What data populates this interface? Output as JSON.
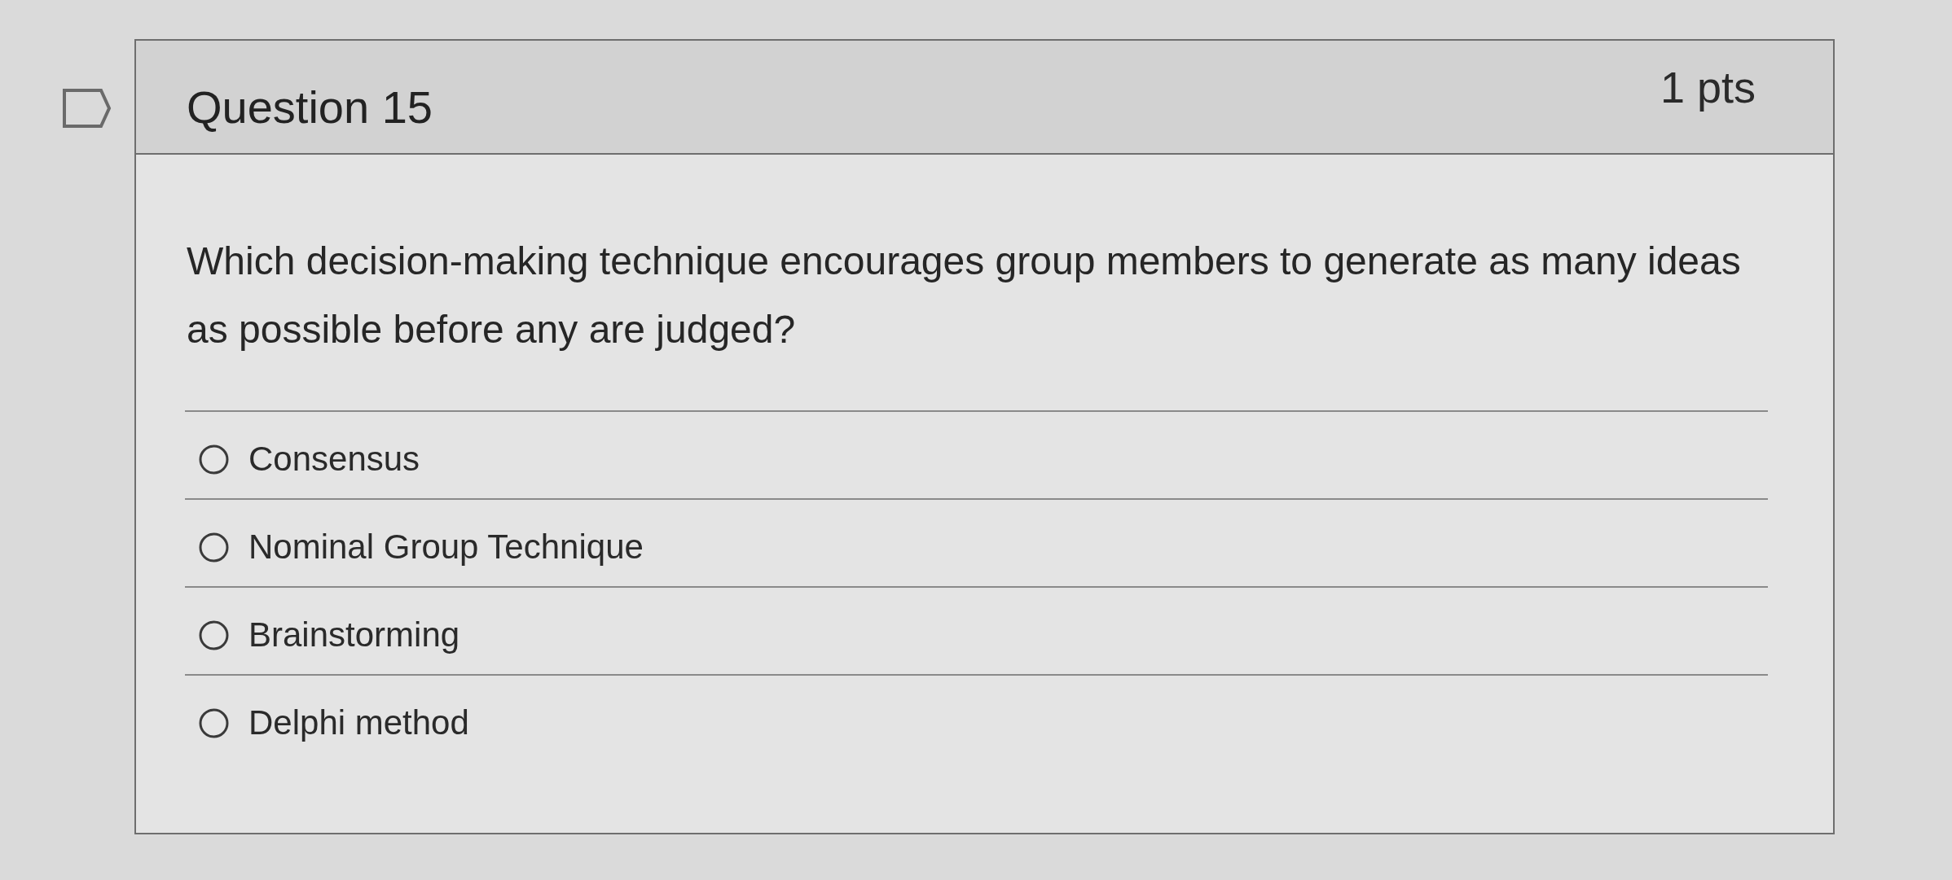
{
  "question": {
    "title": "Question 15",
    "points": "1 pts",
    "text": "Which decision-making technique encourages group members to generate as many ideas as possible before any are judged?",
    "options": [
      {
        "label": "Consensus",
        "selected": false
      },
      {
        "label": "Nominal Group Technique",
        "selected": false
      },
      {
        "label": "Brainstorming",
        "selected": false
      },
      {
        "label": "Delphi method",
        "selected": false
      }
    ]
  }
}
